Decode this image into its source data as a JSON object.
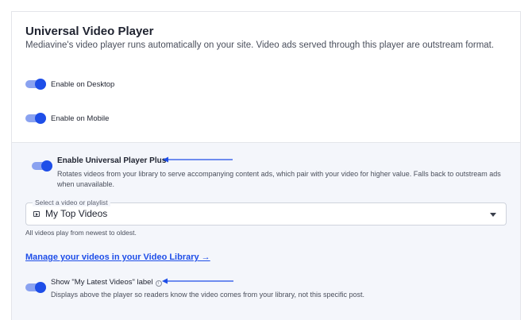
{
  "section": {
    "title": "Universal Video Player",
    "description": "Mediavine's video player runs automatically on your site. Video ads served through this player are outstream format."
  },
  "toggles": {
    "desktop": {
      "label": "Enable on Desktop",
      "on": true
    },
    "mobile": {
      "label": "Enable on Mobile",
      "on": true
    },
    "plus": {
      "label": "Enable Universal Player Plus",
      "on": true
    },
    "latest": {
      "label": "Show \"My Latest Videos\" label",
      "on": true
    }
  },
  "plus": {
    "description": "Rotates videos from your library to serve accompanying content ads, which pair with your video for higher value. Falls back to outstream ads when unavailable.",
    "select": {
      "legend": "Select a video or playlist",
      "value": "My Top Videos",
      "icon": "video-icon"
    },
    "helper": "All videos play from newest to oldest.",
    "manage_link": "Manage your videos in your Video Library →",
    "latest_description": "Displays above the player so readers know the video comes from your library, not this specific post."
  },
  "colors": {
    "accent": "#1e4ee8",
    "toggle_track": "#8aa2f0",
    "panel_bg": "#f4f6fb"
  }
}
